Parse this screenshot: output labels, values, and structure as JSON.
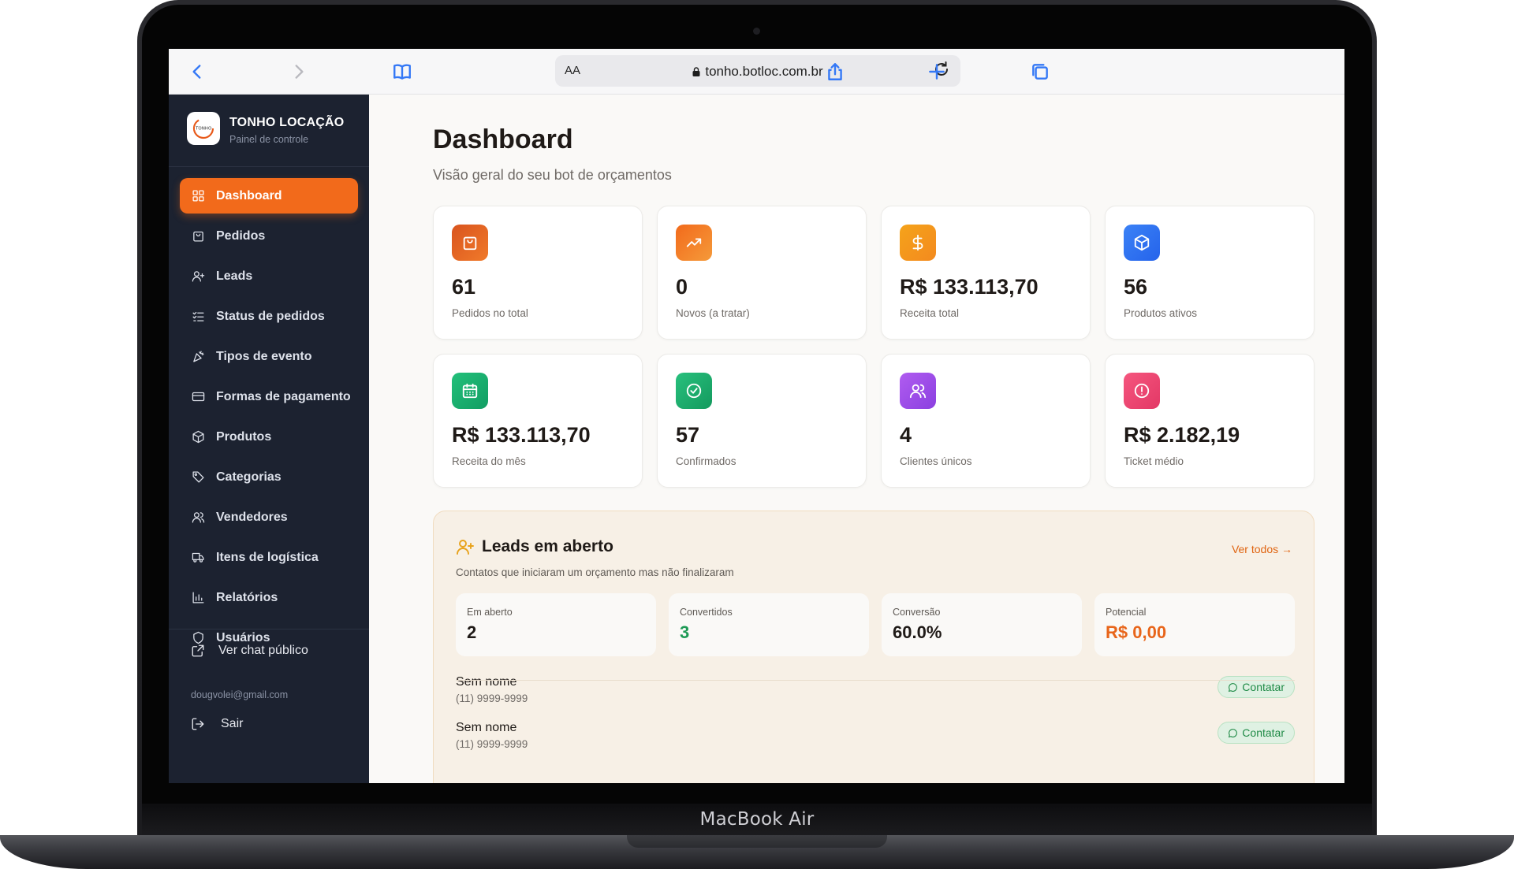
{
  "device": {
    "brand": "MacBook Air"
  },
  "browser": {
    "text_size_label": "AA",
    "url": "tonho.botloc.com.br"
  },
  "sidebar": {
    "brand_name": "TONHO LOCAÇÃO",
    "brand_subtitle": "Painel de controle",
    "items": [
      {
        "label": "Dashboard",
        "icon": "grid-icon",
        "active": true
      },
      {
        "label": "Pedidos",
        "icon": "bag-icon"
      },
      {
        "label": "Leads",
        "icon": "user-plus-icon"
      },
      {
        "label": "Status de pedidos",
        "icon": "list-check-icon"
      },
      {
        "label": "Tipos de evento",
        "icon": "party-icon"
      },
      {
        "label": "Formas de pagamento",
        "icon": "card-icon"
      },
      {
        "label": "Produtos",
        "icon": "box-icon"
      },
      {
        "label": "Categorias",
        "icon": "tag-icon"
      },
      {
        "label": "Vendedores",
        "icon": "users-icon"
      },
      {
        "label": "Itens de logística",
        "icon": "truck-icon"
      },
      {
        "label": "Relatórios",
        "icon": "bar-chart-icon"
      },
      {
        "label": "Usuários",
        "icon": "shield-icon"
      }
    ],
    "public_chat_label": "Ver chat público",
    "user_email": "dougvolei@gmail.com",
    "logout_label": "Sair"
  },
  "main": {
    "title": "Dashboard",
    "subtitle": "Visão geral do seu bot de orçamentos",
    "cards": [
      {
        "value": "61",
        "label": "Pedidos no total",
        "icon": "bag-icon",
        "color_from": "#d9541e",
        "color_to": "#f07a2a"
      },
      {
        "value": "0",
        "label": "Novos (a tratar)",
        "icon": "trending-up-icon",
        "color_from": "#f26a1b",
        "color_to": "#f59a3a"
      },
      {
        "value": "R$ 133.113,70",
        "label": "Receita total",
        "icon": "dollar-icon",
        "color_from": "#f5a31a",
        "color_to": "#f38a1f"
      },
      {
        "value": "56",
        "label": "Produtos ativos",
        "icon": "box-icon",
        "color_from": "#3b82f6",
        "color_to": "#2563eb"
      },
      {
        "value": "R$ 133.113,70",
        "label": "Receita do mês",
        "icon": "calendar-icon",
        "color_from": "#22c07a",
        "color_to": "#129d63"
      },
      {
        "value": "57",
        "label": "Confirmados",
        "icon": "check-circle-icon",
        "color_from": "#28c07d",
        "color_to": "#149a5e"
      },
      {
        "value": "4",
        "label": "Clientes únicos",
        "icon": "users-icon",
        "color_from": "#b05cf0",
        "color_to": "#8b3fe0"
      },
      {
        "value": "R$ 2.182,19",
        "label": "Ticket médio",
        "icon": "alert-circle-icon",
        "color_from": "#f5567e",
        "color_to": "#e33866"
      }
    ]
  },
  "leads": {
    "title": "Leads em aberto",
    "view_all": "Ver todos →",
    "subtitle": "Contatos que iniciaram um orçamento mas não finalizaram",
    "stats": [
      {
        "label": "Em aberto",
        "value": "2",
        "color": "#1f1a17"
      },
      {
        "label": "Convertidos",
        "value": "3",
        "color": "#1e9a55"
      },
      {
        "label": "Conversão",
        "value": "60.0%",
        "color": "#1f1a17"
      },
      {
        "label": "Potencial",
        "value": "R$ 0,00",
        "color": "#e8651a"
      }
    ],
    "rows": [
      {
        "name": "Sem nome",
        "phone": "(11) 9999-9999",
        "action": "Contatar"
      },
      {
        "name": "Sem nome",
        "phone": "(11) 9999-9999",
        "action": "Contatar"
      }
    ]
  }
}
